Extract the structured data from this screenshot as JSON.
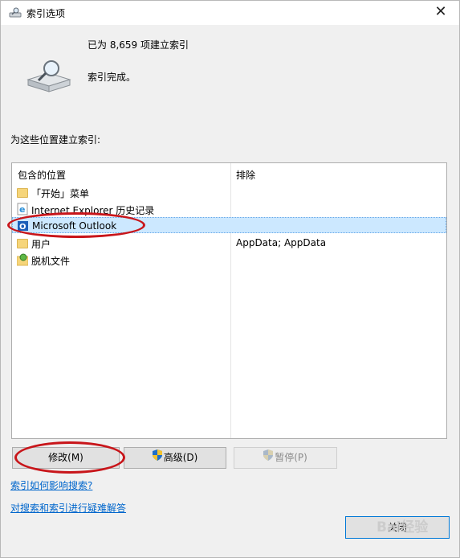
{
  "window": {
    "title": "索引选项",
    "close_glyph": "✕"
  },
  "summary": {
    "count_text": "已为 8,659 项建立索引",
    "status_text": "索引完成。"
  },
  "locations_label": "为这些位置建立索引:",
  "table": {
    "headers": {
      "included": "包含的位置",
      "excluded": "排除"
    },
    "rows": [
      {
        "name": "「开始」菜单",
        "excluded": "",
        "icon": "folder-icon"
      },
      {
        "name": "Internet Explorer 历史记录",
        "excluded": "",
        "icon": "ie-icon"
      },
      {
        "name": "Microsoft Outlook",
        "excluded": "",
        "icon": "outlook-icon",
        "selected": true
      },
      {
        "name": "用户",
        "excluded": "AppData; AppData",
        "icon": "folder-icon"
      },
      {
        "name": "脱机文件",
        "excluded": "",
        "icon": "offline-files-icon"
      }
    ]
  },
  "buttons": {
    "modify": "修改(M)",
    "advanced": "高级(D)",
    "pause": "暂停(P)",
    "close": "关闭"
  },
  "links": {
    "how_affects": "索引如何影响搜索?",
    "troubleshoot": "对搜索和索引进行疑难解答"
  },
  "watermark": "Bai经验"
}
